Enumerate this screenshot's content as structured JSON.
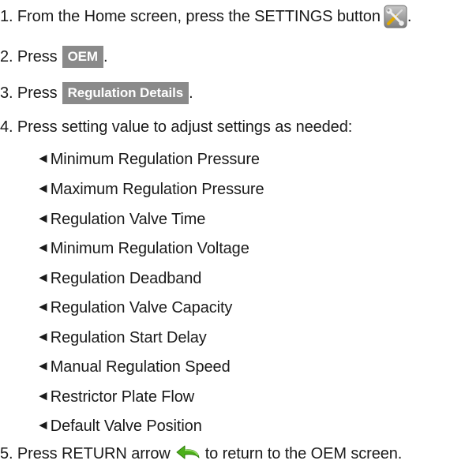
{
  "steps": [
    {
      "pre": "1. From the Home screen, press the SETTINGS button",
      "post": "."
    },
    {
      "pre": "2. Press",
      "chip": "OEM",
      "post": "."
    },
    {
      "pre": "3. Press",
      "chip": "Regulation Details",
      "post": "."
    },
    {
      "text": "4. Press setting value to adjust settings as needed:"
    }
  ],
  "bullet_marker": "◄",
  "settings_list": [
    "Minimum Regulation Pressure",
    "Maximum Regulation Pressure",
    "Regulation Valve Time",
    "Minimum Regulation Voltage",
    "Regulation Deadband",
    "Regulation Valve Capacity",
    "Regulation Start Delay",
    "Manual Regulation Speed",
    "Restrictor Plate Flow",
    "Default Valve Position"
  ],
  "final_step": {
    "pre": "5. Press RETURN arrow",
    "post": "to return to the OEM screen."
  },
  "icons": {
    "settings": "settings-tools-icon",
    "return": "return-arrow-icon"
  },
  "colors": {
    "chip_bg": "#8a8a8a",
    "chip_text": "#ffffff",
    "return_arrow": "#4caf1a"
  }
}
